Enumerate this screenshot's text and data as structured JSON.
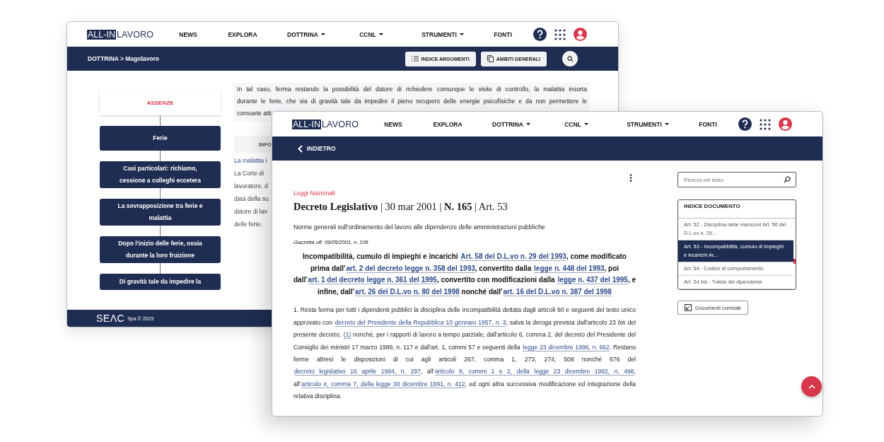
{
  "windows": [
    {
      "header": {
        "logo": {
          "boxed": "ALL-IN",
          "text": "LAVORO"
        },
        "nav": [
          {
            "label": "NEWS",
            "dropdown": false
          },
          {
            "label": "EXPLORA",
            "dropdown": false
          },
          {
            "label": "DOTTRINA",
            "dropdown": true
          },
          {
            "label": "CCNL",
            "dropdown": true
          },
          {
            "label": "STRUMENTI",
            "dropdown": true
          },
          {
            "label": "FONTI",
            "dropdown": false
          }
        ]
      },
      "breadcrumb": "DOTTRINA > Magolavoro",
      "toolbar_buttons": [
        {
          "label": "INDICE ARGOMENTI",
          "kind": "list"
        },
        {
          "label": "AMBITI GENERALI",
          "kind": "copy"
        }
      ],
      "flowchart": {
        "root": "ASSENZE",
        "steps": [
          "Ferie",
          "Casi particolari: richiamo, cessione a colleghi eccetera",
          "La sovrapposizione tra ferie e malattia",
          "Dopo l'inizio delle ferie, ossia durante la loro fruizione",
          "Di gravità tale da impedire la"
        ]
      },
      "note_lines": [
        "In tal caso, ferma restando la possibilità del datore di richiedere comunque le visite di controllo, la malattia insorta",
        "durante le ferie, che sia di gravità tale da impedire il pieno recupero delle energie psicofisiche e da non permettere le",
        "consuete atti"
      ],
      "info_header": "INFO",
      "text_lines": [
        {
          "text": "La malattia i",
          "kind": "link"
        },
        {
          "text": "La Corte di",
          "kind": "plain"
        },
        {
          "text": "lavoratore, d",
          "kind": "plain"
        },
        {
          "text": "data della su",
          "kind": "plain"
        },
        {
          "text": "datore di lav",
          "kind": "plain"
        },
        {
          "text": "delle ferie.",
          "kind": "plain"
        }
      ],
      "footer": {
        "logo": "SEΛC",
        "copyright": "Spa © 2023"
      }
    },
    {
      "header": {
        "logo": {
          "boxed": "ALL-IN",
          "text": "LAVORO"
        },
        "nav": [
          {
            "label": "NEWS",
            "dropdown": false
          },
          {
            "label": "EXPLORA",
            "dropdown": false
          },
          {
            "label": "DOTTRINA",
            "dropdown": true
          },
          {
            "label": "CCNL",
            "dropdown": true
          },
          {
            "label": "STRUMENTI",
            "dropdown": true
          },
          {
            "label": "FONTI",
            "dropdown": false
          }
        ]
      },
      "back_link": "INDIETRO",
      "article": {
        "category": "Leggi Nazionali",
        "title": "**Decreto Legislativo** | 30 mar 2001 | **N. 165** | Art. 53",
        "subtitle": "Norme generali sull'ordinamento del lavoro alle dipendenze delle amministrazioni pubbliche",
        "gazette": "Gazzetta uff. 09/05/2001, n. 106",
        "heading": [
          {
            "text": "Incompatibilità, cumulo di impieghi e incarichi ",
            "link": false
          },
          {
            "text": "Art. 58 del D.L.vo n. 29 del 1993",
            "link": true
          },
          {
            "text": ", come modificato prima dall'",
            "link": false
          },
          {
            "text": "art. 2 del decreto legge n. 358 del 1993",
            "link": true
          },
          {
            "text": ", convertito dalla ",
            "link": false
          },
          {
            "text": "legge n. 448 del 1993",
            "link": true
          },
          {
            "text": ", poi dall'",
            "link": false
          },
          {
            "text": "art. 1 del decreto legge n. 361 del 1995",
            "link": true
          },
          {
            "text": ", convertito con modificazioni dalla ",
            "link": false
          },
          {
            "text": "legge n. 437 del 1995",
            "link": true
          },
          {
            "text": ", e infine, dall'",
            "link": false
          },
          {
            "text": "art. 26 del D.L.vo n. 80 del 1998",
            "link": true
          },
          {
            "text": " nonché dall'",
            "link": false
          },
          {
            "text": "art. 16 del D.L.vo n. 387 del 1998",
            "link": true
          }
        ],
        "paragraph": [
          {
            "text": "1. Resta ferma per tutti i dipendenti pubblici la disciplina delle incompatibilità dettata dagli articoli 60 e seguenti del testo unico approvato con ",
            "link": false
          },
          {
            "text": "decreto del Presidente della Repubblica 10 gennaio 1957, n. 3",
            "link": true
          },
          {
            "text": ", salva la deroga prevista dall'articolo 23 *bis* del presente decreto, ",
            "link": false
          },
          {
            "text": "(1)",
            "link": true
          },
          {
            "text": " nonché, per i rapporti di lavoro a tempo parziale, dall'articolo 6, comma 2, del decreto del Presidente del Consiglio dei ministri 17 marzo 1989, n. 117 e dall'art. 1, commi 57 e seguenti della ",
            "link": false
          },
          {
            "text": "legge 23 dicembre 1996, n. 662",
            "link": true
          },
          {
            "text": ". Restano ferme altresì le disposizioni di cui agli articoli 267, comma 1, 273, 274, 508 nonché 676 del ",
            "link": false
          },
          {
            "text": "decreto legislativo 16 aprile 1994, n. 297",
            "link": true
          },
          {
            "text": ", all'",
            "link": false
          },
          {
            "text": "articolo 9, commi 1 e 2, della legge 23 dicembre 1992, n. 498",
            "link": true
          },
          {
            "text": ", all'",
            "link": false
          },
          {
            "text": "articolo 4, comma 7, della legge 30 dicembre 1991, n. 412",
            "link": true
          },
          {
            "text": ", ed ogni altra successiva modificazione ed integrazione della relativa disciplina.",
            "link": false
          }
        ]
      },
      "search": {
        "placeholder": "Ricerca nel testo"
      },
      "index": {
        "title": "INDICE DOCUMENTO",
        "items": [
          {
            "text": "Art. 52 - Disciplina delle mansioni Art. 56 del D.L.vo n. 29...",
            "selected": false
          },
          {
            "text": "Art. 53 - Incompatibilità, cumulo di impieghi e incarichi Ar...",
            "selected": true
          },
          {
            "text": "Art. 54 - Codice di comportamento",
            "selected": false
          },
          {
            "text": "Art. 54 bis - Tutela del dipendente",
            "selected": false
          }
        ]
      },
      "related_button": "Documenti correlati"
    }
  ]
}
